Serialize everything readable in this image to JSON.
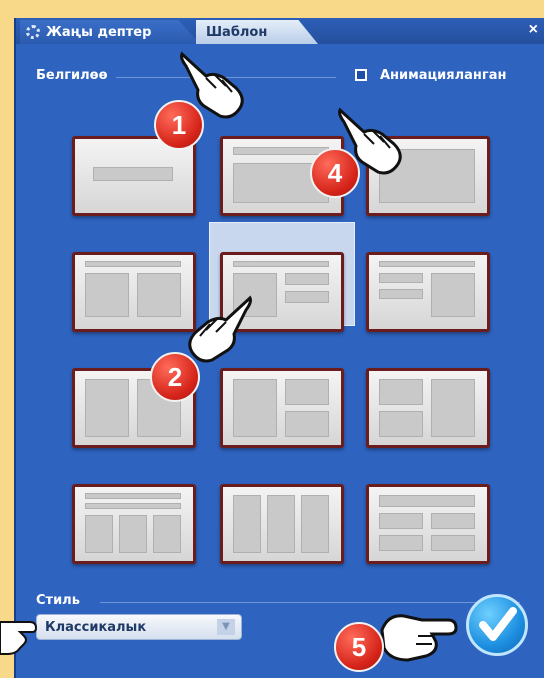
{
  "tabs": {
    "new_notebook": "Жаңы дептер",
    "template": "Шаблон"
  },
  "close": "×",
  "sections": {
    "markings": "Белгилөө",
    "style": "Стиль"
  },
  "animated_label": "Анимацияланган",
  "style_select": {
    "value": "Классикалык",
    "arrow": "▼"
  },
  "callouts": [
    "1",
    "4",
    "2",
    "5"
  ],
  "icons": {
    "settings": "gear-icon",
    "ok": "checkmark-icon",
    "pointer": "hand-pointer-icon"
  },
  "colors": {
    "dialog": "#2e63bf",
    "frame": "#6b1d1d",
    "badge": "#d6241a",
    "ok": "#1d8fe0"
  }
}
